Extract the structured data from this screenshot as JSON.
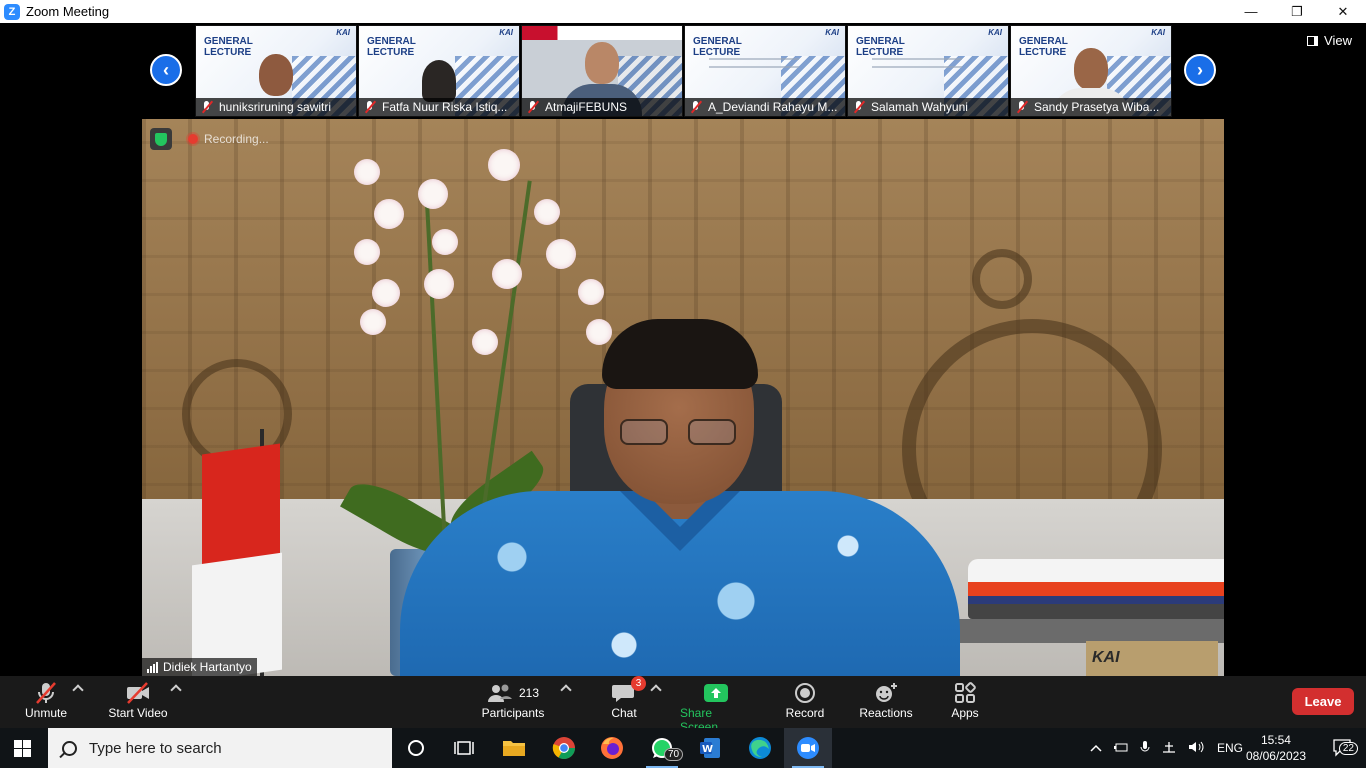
{
  "window": {
    "title": "Zoom Meeting",
    "controls": [
      "—",
      "❐",
      "✕"
    ]
  },
  "gallery": {
    "prev": "‹",
    "next": "›",
    "view_label": "View",
    "slide_title": [
      "GENERAL",
      "LECTURE"
    ],
    "slide_brand": "KAI",
    "participants": [
      {
        "name": "huniksriruning sawitri",
        "type": "slide-person"
      },
      {
        "name": "Fatfa Nuur Riska Istiq...",
        "type": "slide-person"
      },
      {
        "name": "AtmajiFEBUNS",
        "type": "camera"
      },
      {
        "name": "A_Deviandi Rahayu M...",
        "type": "slide"
      },
      {
        "name": "Salamah Wahyuni",
        "type": "slide"
      },
      {
        "name": "Sandy Prasetya Wiba...",
        "type": "slide-person"
      }
    ]
  },
  "main_video": {
    "recording_label": "Recording...",
    "speaker_name": "Didiek Hartantyo",
    "brand_plate": "KAI",
    "train_logo": "KAI"
  },
  "toolbar": {
    "unmute": "Unmute",
    "start_video": "Start Video",
    "participants": "Participants",
    "participants_count": "213",
    "chat": "Chat",
    "chat_badge": "3",
    "share_screen": "Share Screen",
    "record": "Record",
    "reactions": "Reactions",
    "apps": "Apps",
    "leave": "Leave",
    "share_color": "#23c55e",
    "leave_color": "#d32f2f"
  },
  "taskbar": {
    "search_placeholder": "Type here to search",
    "whatsapp_badge": "70",
    "language": "ENG",
    "time": "15:54",
    "date": "08/06/2023",
    "notifications": "22"
  }
}
